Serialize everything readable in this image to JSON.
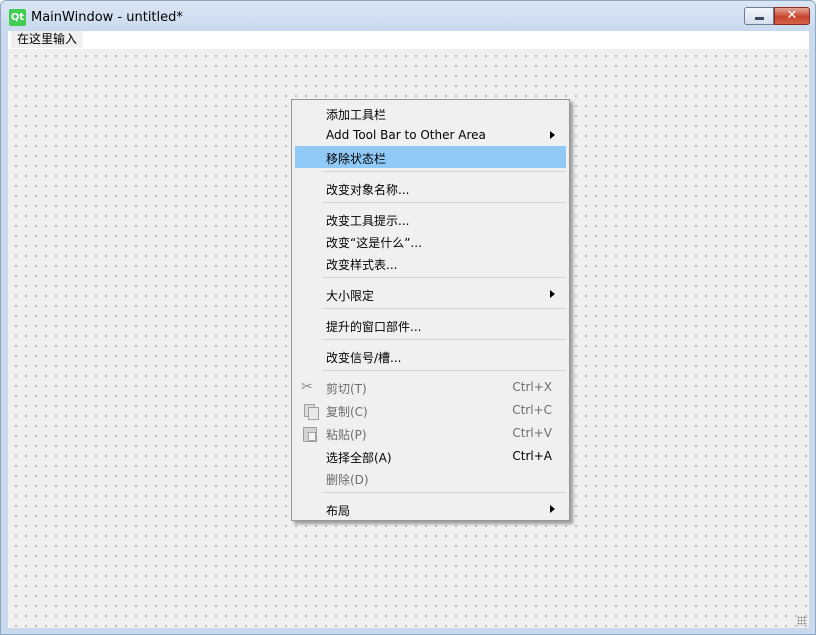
{
  "window": {
    "title": "MainWindow - untitled*",
    "icon_text": "Qt",
    "close_glyph": "✕"
  },
  "menubar": {
    "placeholder_item": "在这里输入"
  },
  "context_menu": {
    "items": [
      {
        "label": "添加工具栏"
      },
      {
        "label": "Add Tool Bar to Other Area",
        "submenu": true
      },
      {
        "label": "移除状态栏",
        "highlighted": true
      },
      {
        "label": "改变对象名称..."
      },
      {
        "label": "改变工具提示..."
      },
      {
        "label": "改变“这是什么”..."
      },
      {
        "label": "改变样式表..."
      },
      {
        "label": "大小限定",
        "submenu": true
      },
      {
        "label": "提升的窗口部件..."
      },
      {
        "label": "改变信号/槽..."
      },
      {
        "label": "剪切(T)",
        "shortcut": "Ctrl+X",
        "disabled": true,
        "icon": "scissors-icon"
      },
      {
        "label": "复制(C)",
        "shortcut": "Ctrl+C",
        "disabled": true,
        "icon": "copy-icon"
      },
      {
        "label": "粘贴(P)",
        "shortcut": "Ctrl+V",
        "disabled": true,
        "icon": "paste-icon"
      },
      {
        "label": "选择全部(A)",
        "shortcut": "Ctrl+A"
      },
      {
        "label": "删除(D)",
        "disabled": true
      },
      {
        "label": "布局",
        "submenu": true
      }
    ]
  },
  "colors": {
    "highlight": "#91c9f7",
    "menu_bg": "#f0f0f0",
    "qt_green": "#41cd52"
  }
}
